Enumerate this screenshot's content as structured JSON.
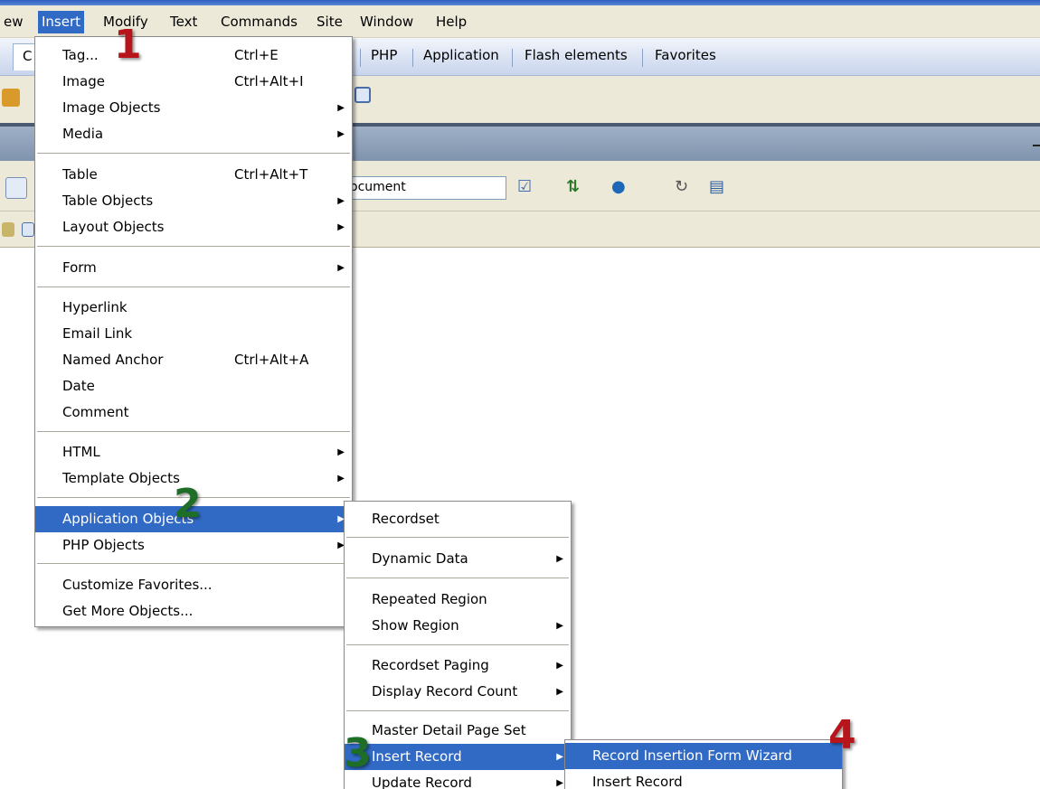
{
  "menubar": {
    "items": [
      "ew",
      "Insert",
      "Modify",
      "Text",
      "Commands",
      "Site",
      "Window",
      "Help"
    ]
  },
  "tabs": {
    "first": "C",
    "items": [
      "PHP",
      "Application",
      "Flash elements",
      "Favorites"
    ]
  },
  "document_toolbar": {
    "title_value": "ocument"
  },
  "insert_menu": {
    "items": [
      {
        "label": "Tag...",
        "shortcut": "Ctrl+E"
      },
      {
        "label": "Image",
        "shortcut": "Ctrl+Alt+I"
      },
      {
        "label": "Image Objects"
      },
      {
        "label": "Media"
      },
      {
        "label": "Table",
        "shortcut": "Ctrl+Alt+T"
      },
      {
        "label": "Table Objects"
      },
      {
        "label": "Layout Objects"
      },
      {
        "label": "Form"
      },
      {
        "label": "Hyperlink"
      },
      {
        "label": "Email Link"
      },
      {
        "label": "Named Anchor",
        "shortcut": "Ctrl+Alt+A"
      },
      {
        "label": "Date"
      },
      {
        "label": "Comment"
      },
      {
        "label": "HTML"
      },
      {
        "label": "Template Objects"
      },
      {
        "label": "Application Objects"
      },
      {
        "label": "PHP Objects"
      },
      {
        "label": "Customize Favorites..."
      },
      {
        "label": "Get More Objects..."
      }
    ]
  },
  "app_objects_menu": {
    "items": [
      {
        "label": "Recordset"
      },
      {
        "label": "Dynamic Data"
      },
      {
        "label": "Repeated Region"
      },
      {
        "label": "Show Region"
      },
      {
        "label": "Recordset Paging"
      },
      {
        "label": "Display Record Count"
      },
      {
        "label": "Master Detail Page Set"
      },
      {
        "label": "Insert Record"
      },
      {
        "label": "Update Record"
      }
    ]
  },
  "insert_record_menu": {
    "items": [
      {
        "label": "Record Insertion Form Wizard"
      },
      {
        "label": "Insert Record"
      }
    ]
  },
  "step_numbers": [
    "1",
    "2",
    "3",
    "4"
  ],
  "colors": {
    "highlight": "#316ac5",
    "step_red": "#b8141c",
    "step_green": "#1f6e28"
  }
}
